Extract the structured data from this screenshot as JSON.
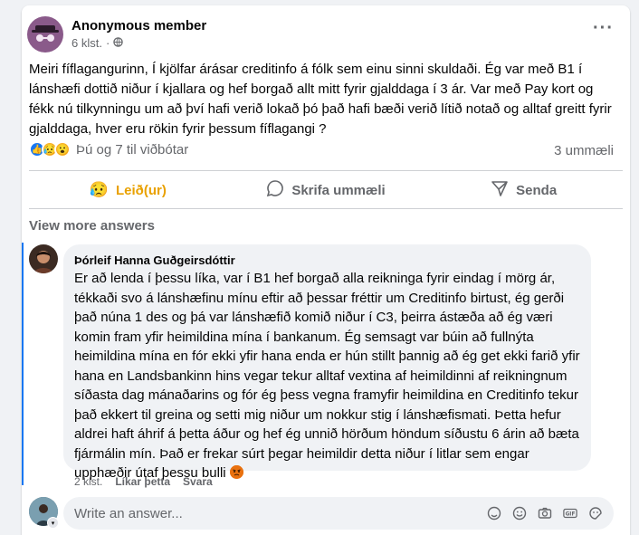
{
  "post": {
    "author": "Anonymous member",
    "time": "6 klst.",
    "separator": "·",
    "text": "Meiri fíflagangurinn, Í kjölfar árásar creditinfo á fólk sem einu sinni skuldaði. Ég var með B1 í lánshæfi dottið niður í kjallara og hef borgað allt mitt fyrir gjalddaga í 3 ár. Var með Pay kort og fékk nú tilkynningu um að því hafi verið lokað þó það hafi bæði verið lítið notað og alltaf greitt fyrir gjalddaga, hver eru rökin fyrir þessum fíflagangi ?",
    "reactions_text": "Þú og 7 til viðbótar",
    "comments_count": "3 ummæli"
  },
  "actions": {
    "react_label": "Leið(ur)",
    "comment_label": "Skrifa ummæli",
    "share_label": "Senda"
  },
  "view_more": "View more answers",
  "comment": {
    "author": "Þórleif Hanna Guðgeirsdóttir",
    "text": "Er að lenda í þessu líka, var í B1 hef borgað alla reikninga fyrir eindag í mörg ár, tékkaði svo á lánshæfinu mínu eftir að þessar fréttir um Creditinfo birtust, ég gerði það núna 1 des og þá var lánshæfið komið niður í C3, þeirra ástæða að ég væri komin fram yfir heimildina mína í bankanum. Ég semsagt var búin að fullnýta heimildina mína en fór ekki yfir hana enda er hún stillt þannig að ég get ekki farið yfir hana en Landsbankinn hins vegar tekur alltaf vextina af heimildinni af reikningnum síðasta dag mánaðarins og fór ég þess vegna framyfir heimildina en Creditinfo tekur það ekkert til greina og setti mig niður um nokkur stig í lánshæfismati. Þetta hefur aldrei haft áhrif á þetta áður og hef ég unnið hörðum höndum síðustu 6 árin að bæta fjármálin mín. Það er frekar súrt þegar heimildir detta niður í litlar sem engar upphæðir útaf þessu bulli",
    "time": "2 klst.",
    "like_label": "Líkar þetta",
    "reply_label": "Svara"
  },
  "answer_input": {
    "placeholder": "Write an answer..."
  },
  "colors": {
    "accent": "#1877f2",
    "sad_reaction": "#e9a100",
    "muted_text": "#65676b"
  }
}
